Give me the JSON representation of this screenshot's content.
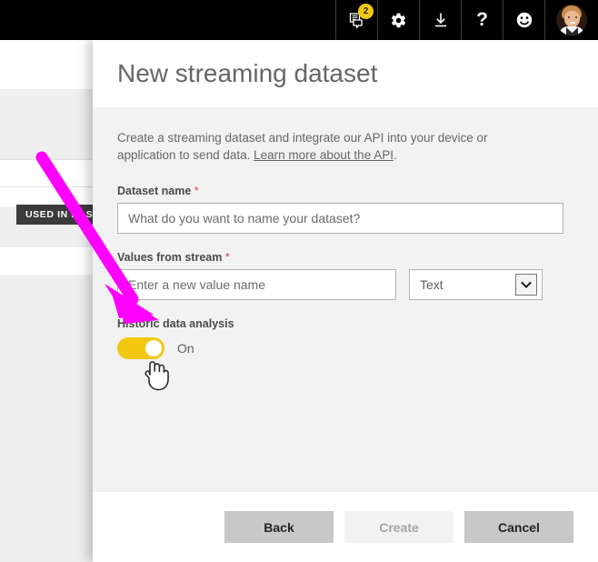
{
  "topbar": {
    "icons": [
      {
        "name": "notifications-icon",
        "badge": "2"
      },
      {
        "name": "settings-gear-icon"
      },
      {
        "name": "download-icon"
      },
      {
        "name": "help-icon",
        "glyph": "?"
      },
      {
        "name": "feedback-smiley-icon"
      }
    ],
    "avatar_alt": "user-avatar"
  },
  "background": {
    "badge_text": "USED IN DASHBOARD"
  },
  "dialog": {
    "title": "New streaming dataset",
    "description_before": "Create a streaming dataset and integrate our API into your device or application to send data. ",
    "description_link": "Learn more about the API",
    "description_after": ".",
    "dataset_name": {
      "label": "Dataset name",
      "required_marker": "*",
      "placeholder": "What do you want to name your dataset?",
      "value": ""
    },
    "values_from_stream": {
      "label": "Values from stream",
      "required_marker": "*",
      "placeholder": "Enter a new value name",
      "value": "",
      "type_selected": "Text"
    },
    "historic_data": {
      "label": "Historic data analysis",
      "state_label": "On",
      "enabled": true,
      "accent_color": "#F2C811"
    },
    "buttons": {
      "back": "Back",
      "create": "Create",
      "cancel": "Cancel"
    }
  },
  "annotation": {
    "arrow_color": "#FF00FF"
  }
}
